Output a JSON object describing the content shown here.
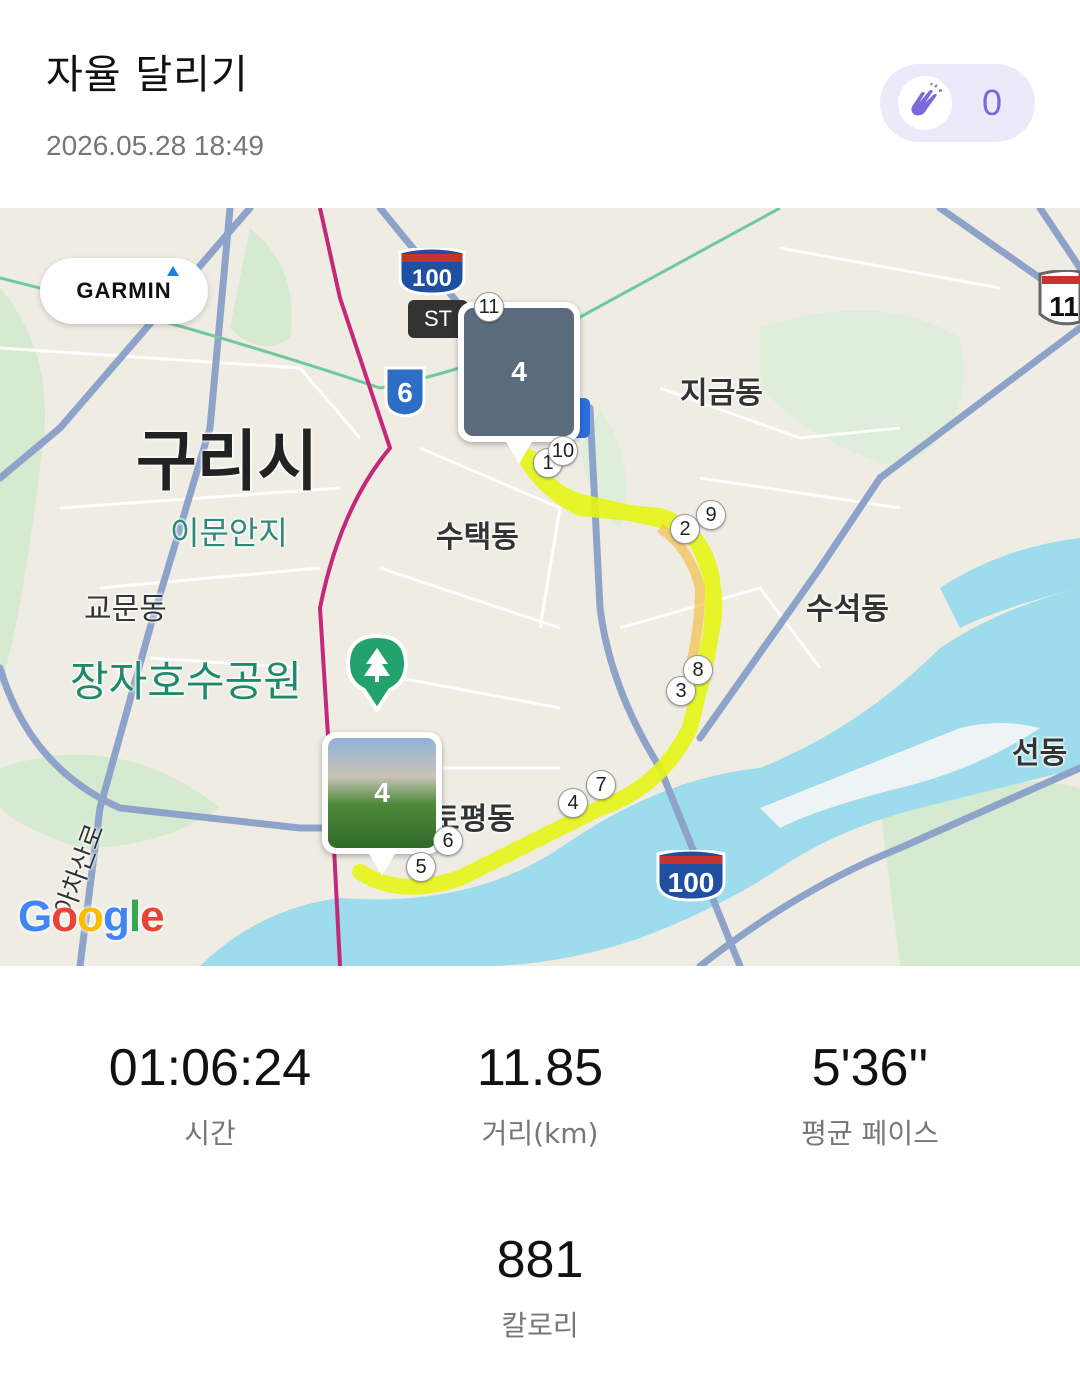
{
  "header": {
    "title": "자율 달리기",
    "datetime": "2026.05.28 18:49",
    "clap_icon": "clap-hands-icon",
    "clap_count": "0"
  },
  "map": {
    "garmin_label": "GARMIN",
    "google_letters": [
      "G",
      "o",
      "o",
      "g",
      "l",
      "e"
    ],
    "labels": {
      "guri": "구리시",
      "imunanji": "이문안지",
      "gyomun": "교문동",
      "jangja": "장자호수공원",
      "sutaek": "수택동",
      "jigeum": "지금동",
      "suseok": "수석동",
      "seon": "선동",
      "topyeong": "토평동",
      "ayachaoro": "아차산로",
      "st": "ST",
      "route100_top": "100",
      "route100_bottom": "100",
      "route6": "6",
      "route_right": "11"
    },
    "photos": [
      {
        "count": "4"
      },
      {
        "count": "4"
      }
    ],
    "km_markers": [
      "1",
      "10",
      "2",
      "9",
      "3",
      "8",
      "4",
      "7",
      "5",
      "6",
      "11"
    ],
    "colors": {
      "route": "#e6f516",
      "water": "#9ddcec",
      "park": "#cde8c6",
      "road": "#ffffff",
      "highway": "#8ea3c9"
    }
  },
  "stats": {
    "time": {
      "value": "01:06:24",
      "label": "시간"
    },
    "distance": {
      "value": "11.85",
      "label": "거리(km)"
    },
    "pace": {
      "value": "5'36''",
      "label": "평균 페이스"
    },
    "calories": {
      "value": "881",
      "label": "칼로리"
    }
  }
}
